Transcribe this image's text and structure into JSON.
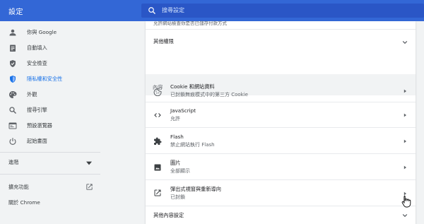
{
  "header": {
    "title": "設定",
    "search_placeholder": "搜尋設定"
  },
  "sidebar": {
    "items": [
      {
        "label": "你與 Google",
        "icon": "person-icon"
      },
      {
        "label": "自動填入",
        "icon": "clipboard-icon"
      },
      {
        "label": "安全檢查",
        "icon": "shield-check-icon"
      },
      {
        "label": "隱私權和安全性",
        "icon": "shield-icon",
        "active": true
      },
      {
        "label": "外觀",
        "icon": "palette-icon"
      },
      {
        "label": "搜尋引擎",
        "icon": "search-icon"
      },
      {
        "label": "預設瀏覽器",
        "icon": "browser-icon"
      },
      {
        "label": "起始畫面",
        "icon": "power-icon"
      }
    ],
    "advanced_label": "進階",
    "extensions_label": "擴充功能",
    "about_label": "關於 Chrome"
  },
  "content": {
    "cut_off_text": "允許網站檢查你是否已儲存付款方式",
    "more_permissions_label": "其他權限",
    "section_title": "內容",
    "rows": [
      {
        "title": "Cookie 和網站資料",
        "subtitle": "已封鎖無痕模式中的第三方 Cookie",
        "icon": "cookie-icon"
      },
      {
        "title": "JavaScript",
        "subtitle": "允許",
        "icon": "code-icon"
      },
      {
        "title": "Flash",
        "subtitle": "禁止網站執行 Flash",
        "icon": "puzzle-icon"
      },
      {
        "title": "圖片",
        "subtitle": "全部顯示",
        "icon": "image-icon"
      },
      {
        "title": "彈出式視窗與重新導向",
        "subtitle": "已封鎖",
        "icon": "open-in-new-icon"
      }
    ],
    "more_content_settings_label": "其他內容設定"
  },
  "colors": {
    "header_bg": "#3367d6",
    "search_bg": "#2a56c6",
    "accent": "#1a73e8",
    "page_bg": "#f1f3f4"
  }
}
